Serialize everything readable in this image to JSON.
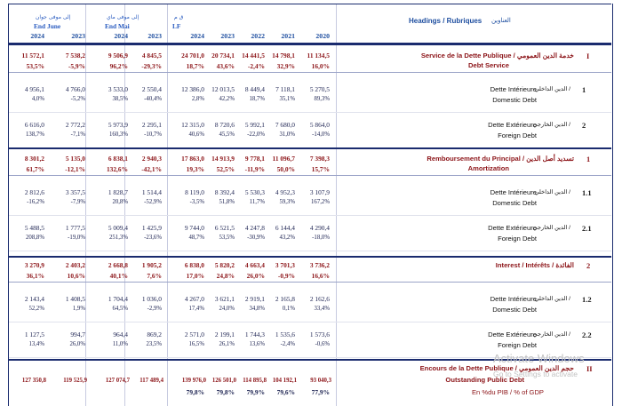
{
  "header": {
    "groups": [
      {
        "ar": "إلى موفى جوان",
        "fr": "End June"
      },
      {
        "ar": "إلى موفى ماي",
        "fr": "End Mai"
      },
      {
        "ar": "ق م",
        "fr": "LF"
      }
    ],
    "years": [
      "2024",
      "2023",
      "2024",
      "2023",
      "2024",
      "2023",
      "2022",
      "2021",
      "2020"
    ],
    "headings_fr": "Headings / Rubriques",
    "headings_ar": "العناوين"
  },
  "sections": [
    {
      "index": "I",
      "label_fr": "Service de la Dette Publique /",
      "label_ar": "خدمة الدين العمومي",
      "label_en": "Debt Service",
      "values": [
        "11 572,1",
        "7 538,2",
        "9 506,9",
        "4 845,5",
        "24 701,0",
        "20 734,1",
        "14 441,5",
        "14 798,1",
        "11 134,5"
      ],
      "pcts": [
        "53,5%",
        "-5,9%",
        "96,2%",
        "-29,3%",
        "18,7%",
        "43,6%",
        "-2,4%",
        "32,9%",
        "16,0%"
      ],
      "rows": [
        {
          "index": "1",
          "label_fr": "Dette Intérieure",
          "label_ar": "الدين الداخلي /",
          "label_en": "Domestic Debt",
          "values": [
            "4 956,1",
            "4 766,0",
            "3 533,0",
            "2 550,4",
            "12 386,0",
            "12 013,5",
            "8 449,4",
            "7 118,1",
            "5 270,5"
          ],
          "pcts": [
            "4,0%",
            "-5,2%",
            "38,5%",
            "-40,4%",
            "2,8%",
            "42,2%",
            "18,7%",
            "35,1%",
            "89,3%"
          ]
        },
        {
          "index": "2",
          "label_fr": "Dette Extérieure",
          "label_ar": "الدين الخارجي /",
          "label_en": "Foreign Debt",
          "values": [
            "6 616,0",
            "2 772,2",
            "5 973,9",
            "2 295,1",
            "12 315,0",
            "8 720,6",
            "5 992,1",
            "7 680,0",
            "5 864,0"
          ],
          "pcts": [
            "138,7%",
            "-7,1%",
            "160,3%",
            "-10,7%",
            "40,6%",
            "45,5%",
            "-22,0%",
            "31,0%",
            "-14,0%"
          ]
        }
      ]
    },
    {
      "index": "1",
      "label_fr": "Remboursement du Principal /",
      "label_ar": "تسديد أصل الدين",
      "label_en": "Amortization",
      "values": [
        "8 301,2",
        "5 135,0",
        "6 838,1",
        "2 940,3",
        "17 863,0",
        "14 913,9",
        "9 778,1",
        "11 096,7",
        "7 398,3"
      ],
      "pcts": [
        "61,7%",
        "-12,1%",
        "132,6%",
        "-42,1%",
        "19,3%",
        "52,5%",
        "-11,9%",
        "50,0%",
        "15,7%"
      ],
      "rows": [
        {
          "index": "1.1",
          "label_fr": "Dette Intérieure",
          "label_ar": "الدين الداخلي /",
          "label_en": "Domestic Debt",
          "values": [
            "2 812,6",
            "3 357,5",
            "1 828,7",
            "1 514,4",
            "8 119,0",
            "8 392,4",
            "5 530,3",
            "4 952,3",
            "3 107,9"
          ],
          "pcts": [
            "-16,2%",
            "-7,9%",
            "20,8%",
            "-52,9%",
            "-3,5%",
            "51,8%",
            "11,7%",
            "59,3%",
            "167,2%"
          ]
        },
        {
          "index": "2.1",
          "label_fr": "Dette Extérieure",
          "label_ar": "الدين الخارجي /",
          "label_en": "Foreign Debt",
          "values": [
            "5 488,5",
            "1 777,5",
            "5 009,4",
            "1 425,9",
            "9 744,0",
            "6 521,5",
            "4 247,8",
            "6 144,4",
            "4 290,4"
          ],
          "pcts": [
            "208,8%",
            "-19,0%",
            "251,3%",
            "-23,6%",
            "48,7%",
            "53,5%",
            "-30,9%",
            "43,2%",
            "-18,0%"
          ]
        }
      ]
    },
    {
      "index": "2",
      "label_fr": "Interest / Intérêts /",
      "label_ar": "الفائدة",
      "label_en": "",
      "values": [
        "3 270,9",
        "2 403,2",
        "2 668,8",
        "1 905,2",
        "6 838,0",
        "5 820,2",
        "4 663,4",
        "3 701,3",
        "3 736,2"
      ],
      "pcts": [
        "36,1%",
        "10,6%",
        "40,1%",
        "7,6%",
        "17,0%",
        "24,8%",
        "26,0%",
        "-0,9%",
        "16,6%"
      ],
      "rows": [
        {
          "index": "1.2",
          "label_fr": "Dette Intérieure",
          "label_ar": "الدين الداخلي /",
          "label_en": "Domestic Debt",
          "values": [
            "2 143,4",
            "1 408,5",
            "1 704,4",
            "1 036,0",
            "4 267,0",
            "3 621,1",
            "2 919,1",
            "2 165,8",
            "2 162,6"
          ],
          "pcts": [
            "52,2%",
            "1,9%",
            "64,5%",
            "-2,9%",
            "17,4%",
            "24,0%",
            "34,8%",
            "0,1%",
            "33,4%"
          ]
        },
        {
          "index": "2.2",
          "label_fr": "Dette Extérieure",
          "label_ar": "الدين الخارجي /",
          "label_en": "Foreign Debt",
          "values": [
            "1 127,5",
            "994,7",
            "964,4",
            "869,2",
            "2 571,0",
            "2 199,1",
            "1 744,3",
            "1 535,6",
            "1 573,6"
          ],
          "pcts": [
            "13,4%",
            "26,0%",
            "11,0%",
            "23,5%",
            "16,5%",
            "26,1%",
            "13,6%",
            "-2,4%",
            "-0,6%"
          ]
        }
      ]
    }
  ],
  "outstanding": {
    "index": "II",
    "label_fr": "Encours de la Dette Publique /",
    "label_ar": "حجم الدين العمومي",
    "label_en": "Outstanding  Public Debt",
    "values": [
      "127 350,8",
      "119 525,9",
      "127 074,7",
      "117 489,4",
      "139 976,0",
      "126 501,0",
      "114 895,8",
      "104 192,1",
      "93 040,3"
    ],
    "gdp_label": "En %du PIB / % of GDP",
    "gdp": [
      "",
      "",
      "",
      "",
      "79,8%",
      "79,8%",
      "79,9%",
      "79,6%",
      "77,9%"
    ]
  },
  "watermark": {
    "title": "Activate Windows",
    "subtitle": "Go to Settings to activate"
  }
}
